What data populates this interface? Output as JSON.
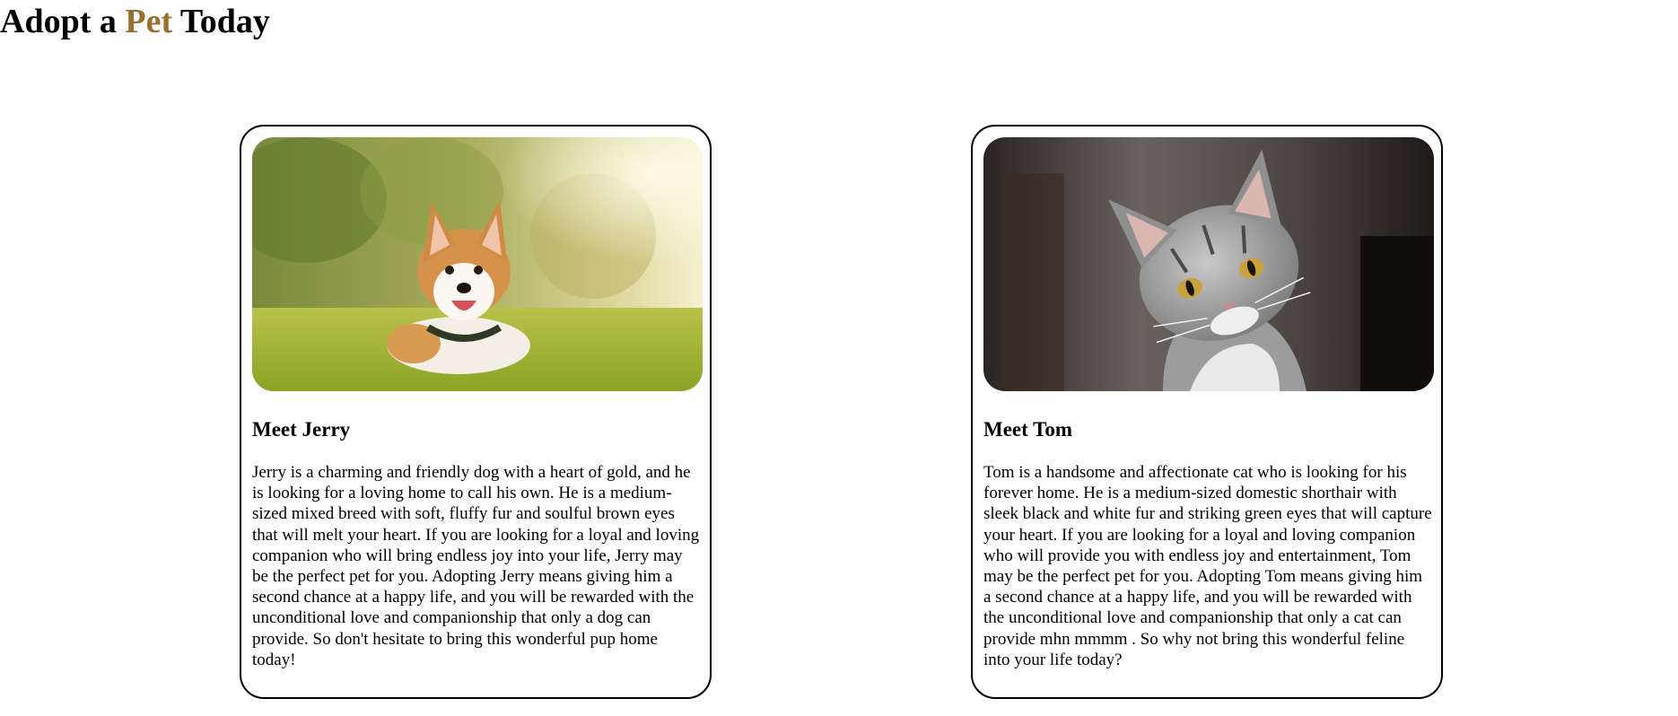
{
  "header": {
    "title_part1": "Adopt a ",
    "title_accent": "Pet",
    "title_part2": " Today",
    "accent_color": "#9a6f2e"
  },
  "pets": [
    {
      "name_heading": "Meet Jerry",
      "image": "corgi-dog-photo",
      "description": "Jerry is a charming and friendly dog with a heart of gold, and he is looking for a loving home to call his own. He is a medium-sized mixed breed with soft, fluffy fur and soulful brown eyes that will melt your heart. If you are looking for a loyal and loving companion who will bring endless joy into your life, Jerry may be the perfect pet for you. Adopting Jerry means giving him a second chance at a happy life, and you will be rewarded with the unconditional love and companionship that only a dog can provide. So don't hesitate to bring this wonderful pup home today!"
    },
    {
      "name_heading": "Meet Tom",
      "image": "gray-tabby-cat-photo",
      "description": "Tom is a handsome and affectionate cat who is looking for his forever home. He is a medium-sized domestic shorthair with sleek black and white fur and striking green eyes that will capture your heart. If you are looking for a loyal and loving companion who will provide you with endless joy and entertainment, Tom may be the perfect pet for you. Adopting Tom means giving him a second chance at a happy life, and you will be rewarded with the unconditional love and companionship that only a cat can provide mhn mmmm . So why not bring this wonderful feline into your life today?"
    }
  ]
}
